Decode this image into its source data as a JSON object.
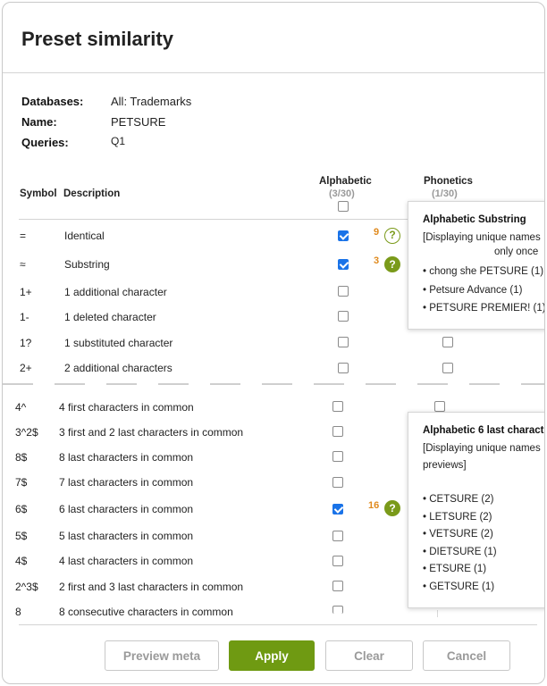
{
  "dialog": {
    "title": "Preset similarity"
  },
  "info": {
    "databases_label": "Databases:",
    "databases_value": "All: Trademarks",
    "name_label": "Name:",
    "name_value": "PETSURE",
    "queries_label": "Queries:",
    "queries_value": "Q1"
  },
  "table": {
    "symbol_header": "Symbol",
    "description_header": "Description",
    "alphabetic_header": "Alphabetic",
    "alphabetic_count": "(3/30)",
    "phonetics_header": "Phonetics",
    "phonetics_count": "(1/30)"
  },
  "rows_top": [
    {
      "symbol": "=",
      "description": "Identical",
      "alpha_checked": true,
      "hits": "9",
      "help_style": "outline"
    },
    {
      "symbol": "≈",
      "description": "Substring",
      "alpha_checked": true,
      "hits": "3",
      "help_style": "filled"
    },
    {
      "symbol": "1+",
      "description": "1 additional character",
      "alpha_checked": false
    },
    {
      "symbol": "1-",
      "description": "1 deleted character",
      "alpha_checked": false
    },
    {
      "symbol": "1?",
      "description": "1 substituted character",
      "alpha_checked": false
    },
    {
      "symbol": "2+",
      "description": "2 additional characters",
      "alpha_checked": false
    }
  ],
  "rows_bottom": [
    {
      "symbol": "4^",
      "description": "4 first characters in common",
      "alpha_checked": false
    },
    {
      "symbol": "3^2$",
      "description": "3 first and 2 last characters in common",
      "alpha_checked": false
    },
    {
      "symbol": "8$",
      "description": "8 last characters in common",
      "alpha_checked": false
    },
    {
      "symbol": "7$",
      "description": "7 last characters in common",
      "alpha_checked": false
    },
    {
      "symbol": "6$",
      "description": "6 last characters in common",
      "alpha_checked": true,
      "hits": "16",
      "help_style": "filled"
    },
    {
      "symbol": "5$",
      "description": "5 last characters in common",
      "alpha_checked": false
    },
    {
      "symbol": "4$",
      "description": "4 last characters in common",
      "alpha_checked": false
    },
    {
      "symbol": "2^3$",
      "description": "2 first and 3 last characters in common",
      "alpha_checked": false
    },
    {
      "symbol": "8",
      "description": "8 consecutive characters in common",
      "alpha_checked": false
    }
  ],
  "popup1": {
    "title": "Alphabetic Substring",
    "note_line1": "[Displaying unique names",
    "note_line2": "only once",
    "items": [
      "• chong she PETSURE (1)",
      "• Petsure Advance (1)",
      "• PETSURE PREMIER! (1)"
    ]
  },
  "popup2": {
    "title": "Alphabetic 6 last charact",
    "note_line1": "[Displaying unique names",
    "note_line2": "previews]",
    "items": [
      "• CETSURE (2)",
      "• LETSURE (2)",
      "• VETSURE (2)",
      "• DIETSURE (1)",
      "• ETSURE (1)",
      "• GETSURE (1)"
    ]
  },
  "buttons": {
    "preview_meta": "Preview meta",
    "apply": "Apply",
    "clear": "Clear",
    "cancel": "Cancel"
  },
  "icons": {
    "help": "question-mark-circle-icon",
    "help_glyph": "?"
  },
  "colors": {
    "primary": "#6f9a12",
    "checkbox": "#1a73e8",
    "hit_count": "#e08a1e"
  }
}
